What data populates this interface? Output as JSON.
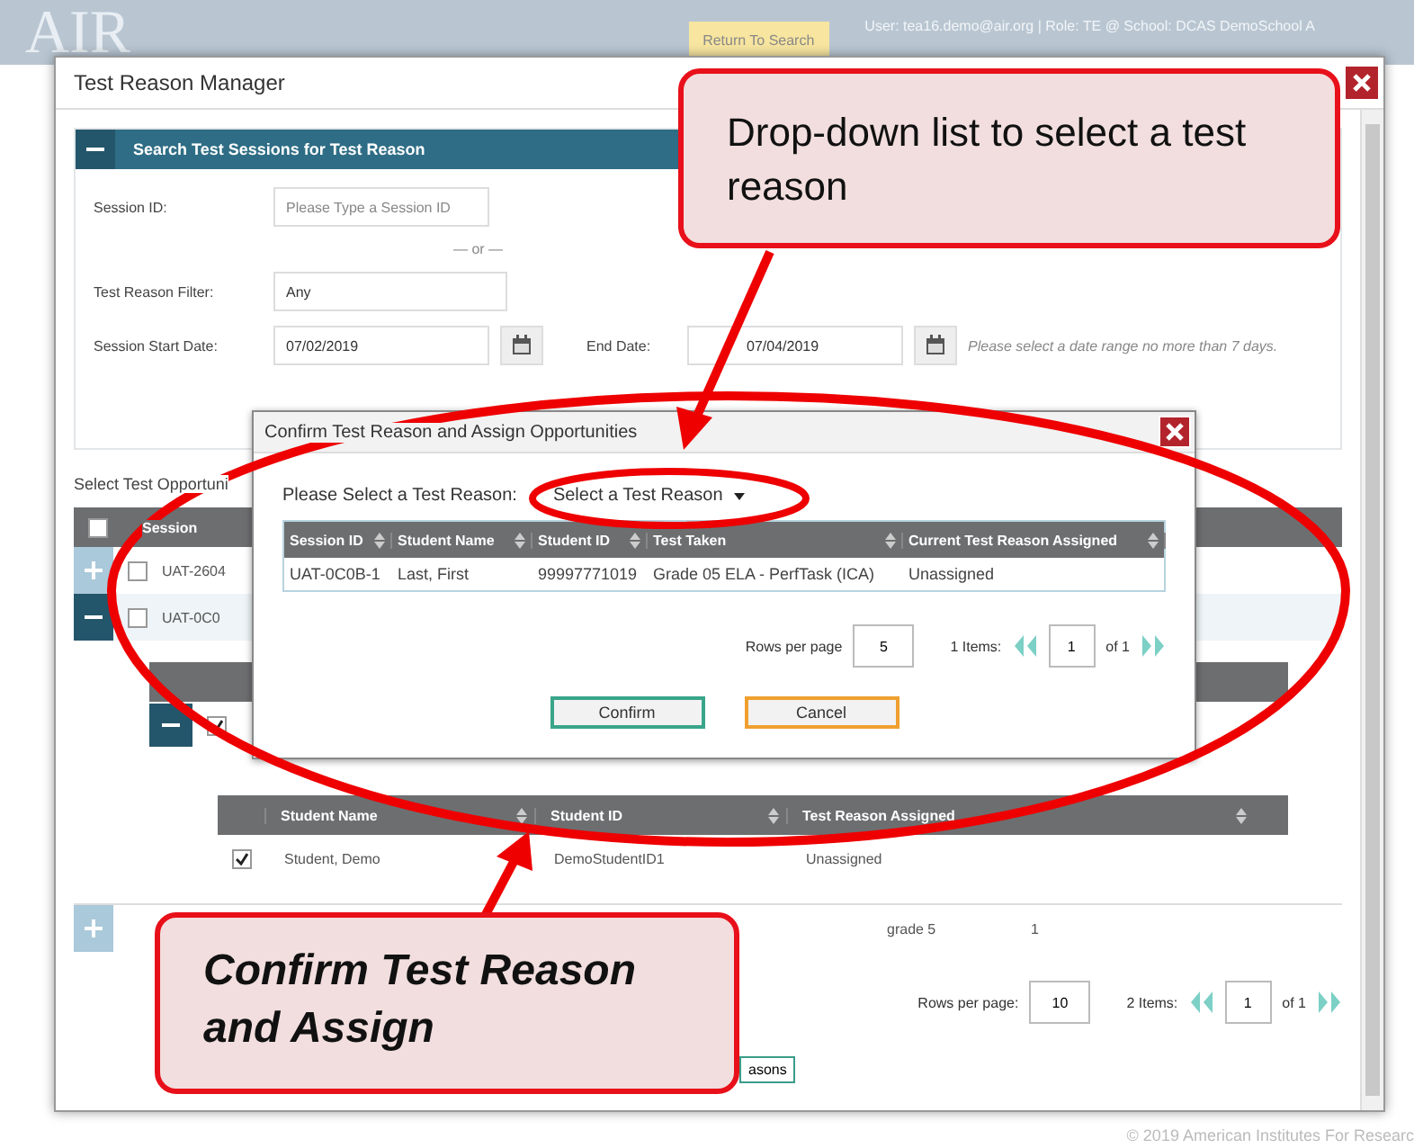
{
  "header": {
    "logo": "AIR",
    "banner_button": "Return To Search",
    "user_info": "User: tea16.demo@air.org  |  Role: TE @ School: DCAS DemoSchool A"
  },
  "dialog": {
    "title": "Test Reason Manager",
    "search_panel": {
      "title": "Search Test Sessions for Test Reason",
      "expanded": true,
      "session_id": {
        "label": "Session ID:",
        "placeholder": "Please Type a Session ID"
      },
      "separator": "— or —",
      "filter": {
        "label": "Test Reason Filter:",
        "value": "Any"
      },
      "start_date": {
        "label": "Session Start Date:",
        "value": "07/02/2019"
      },
      "end_date": {
        "label": "End Date:",
        "value": "07/04/2019"
      },
      "date_hint": "Please select a date range no more than 7 days."
    },
    "opportunities": {
      "title": "Select Test Opportuni",
      "column_1": "Session",
      "all_checked": false,
      "rows": [
        {
          "session": "UAT-2604",
          "checked": false,
          "expanded": false
        },
        {
          "session": "UAT-0C0",
          "checked": false,
          "expanded": true
        }
      ],
      "sub_checked": true,
      "students": {
        "columns": [
          "Student Name",
          "Student ID",
          "Test Reason Assigned"
        ],
        "rows": [
          {
            "checked": true,
            "cells": [
              "Student, Demo",
              "DemoStudentID1",
              "Unassigned"
            ]
          }
        ]
      },
      "next_row": [
        "grade 5",
        "1"
      ],
      "pagination": {
        "rows_label": "Rows per page:",
        "rows": "10",
        "items": "2 Items:",
        "page": "1",
        "of": "of 1"
      },
      "button": "asons"
    }
  },
  "confirm_dialog": {
    "title": "Confirm Test Reason and Assign Opportunities",
    "select_label": "Please Select a Test Reason:",
    "select_value": "Select a Test Reason",
    "columns": [
      "Session ID",
      "Student Name",
      "Student ID",
      "Test Taken",
      "Current Test Reason Assigned"
    ],
    "rows": [
      [
        "UAT-0C0B-1",
        "Last, First",
        "99997771019",
        "Grade 05 ELA - PerfTask (ICA)",
        "Unassigned"
      ]
    ],
    "pagination": {
      "rows_label": "Rows per page",
      "rows": "5",
      "items": "1 Items:",
      "page": "1",
      "of": "of 1"
    },
    "buttons": [
      {
        "label": "Confirm",
        "kind": "confirm"
      },
      {
        "label": "Cancel",
        "kind": "cancel"
      }
    ]
  },
  "callouts": [
    {
      "text": "Drop-down list to select a test reason",
      "italic": false
    },
    {
      "text": "Confirm Test Reason and Assign",
      "italic": true
    }
  ],
  "footer": "© 2019 American Institutes For Researc"
}
